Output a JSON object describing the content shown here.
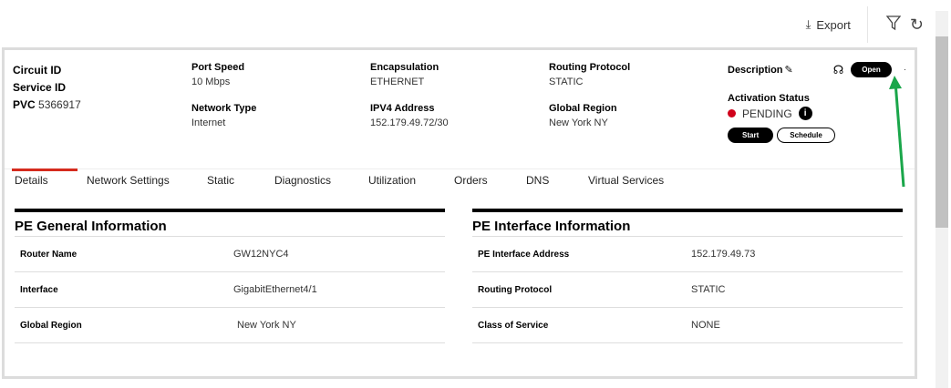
{
  "toolbar": {
    "export_label": "Export"
  },
  "header": {
    "circuit_id_label": "Circuit ID",
    "service_id_label": "Service ID",
    "pvc_label": "PVC",
    "pvc_value": "5366917",
    "port_speed_label": "Port Speed",
    "port_speed": "10 Mbps",
    "network_type_label": "Network Type",
    "network_type": "Internet",
    "encapsulation_label": "Encapsulation",
    "encapsulation": "ETHERNET",
    "ipv4_label": "IPV4 Address",
    "ipv4": "152.179.49.72/30",
    "routing_protocol_label": "Routing Protocol",
    "routing_protocol": "STATIC",
    "global_region_label": "Global Region",
    "global_region": "New York NY",
    "description_label": "Description",
    "open_label": "Open",
    "activation_status_label": "Activation Status",
    "activation_status": "PENDING",
    "start_label": "Start",
    "schedule_label": "Schedule",
    "status_color": "#d0021b"
  },
  "tabs": [
    "Details",
    "Network Settings",
    "Static",
    "Diagnostics",
    "Utilization",
    "Orders",
    "DNS",
    "Virtual Services"
  ],
  "pe_general": {
    "title": "PE General Information",
    "rows": [
      {
        "k": "Router Name",
        "v": "GW12NYC4"
      },
      {
        "k": "Interface",
        "v": "GigabitEthernet4/1"
      },
      {
        "k": "Global Region",
        "v": "New York NY"
      }
    ]
  },
  "pe_interface": {
    "title": "PE Interface Information",
    "rows": [
      {
        "k": "PE Interface Address",
        "v": "152.179.49.73"
      },
      {
        "k": "Routing Protocol",
        "v": "STATIC"
      },
      {
        "k": "Class of Service",
        "v": "NONE"
      }
    ]
  }
}
